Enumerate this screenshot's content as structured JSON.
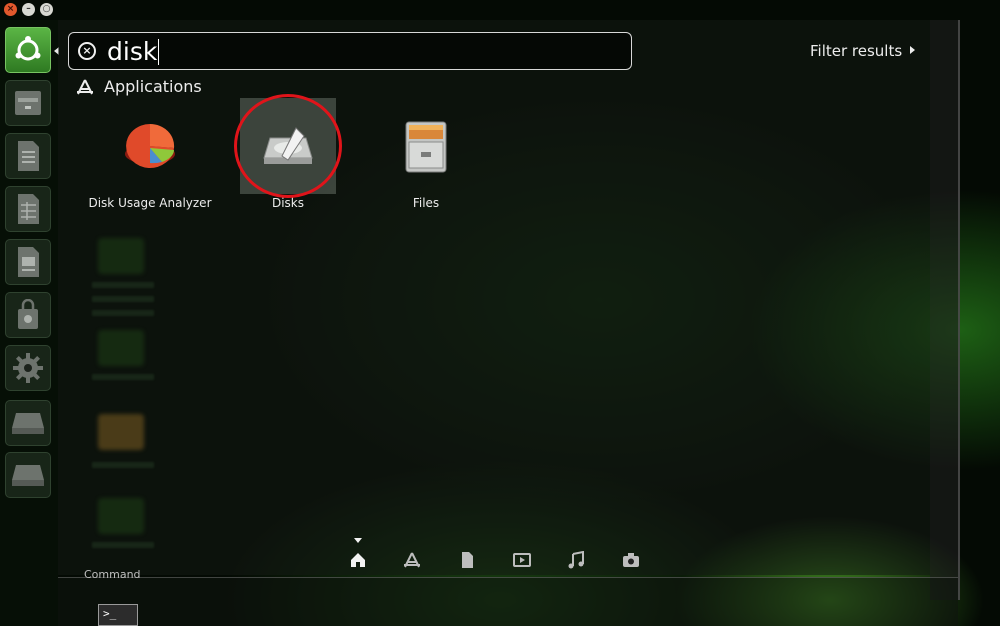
{
  "window_controls": {
    "close_glyph": "×",
    "minimize_glyph": "–",
    "maximize_glyph": "○"
  },
  "launcher": {
    "items": [
      {
        "icon": "ubuntu-logo-icon"
      },
      {
        "icon": "files-drawer-icon"
      },
      {
        "icon": "writer-document-icon"
      },
      {
        "icon": "calc-spreadsheet-icon"
      },
      {
        "icon": "impress-presentation-icon"
      },
      {
        "icon": "software-center-bag-icon"
      },
      {
        "icon": "system-settings-gear-icon"
      },
      {
        "icon": "drive-icon"
      },
      {
        "icon": "drive-icon"
      }
    ]
  },
  "search": {
    "query": "disk",
    "clear_glyph": "×"
  },
  "filter": {
    "label": "Filter results"
  },
  "section": {
    "title": "Applications",
    "icon": "applications-lens-icon"
  },
  "results": [
    {
      "label": "Disk Usage Analyzer",
      "icon": "pie-chart-icon"
    },
    {
      "label": "Disks",
      "icon": "disk-utility-icon",
      "selected": true
    },
    {
      "label": "Files",
      "icon": "file-cabinet-icon"
    }
  ],
  "lenses": [
    {
      "name": "home-lens",
      "active": true
    },
    {
      "name": "applications-lens"
    },
    {
      "name": "files-lens"
    },
    {
      "name": "video-lens"
    },
    {
      "name": "music-lens"
    },
    {
      "name": "photo-lens"
    }
  ],
  "bottom": {
    "partial_label": "Command",
    "terminal_prompt": ">_"
  },
  "colors": {
    "accent_green": "#4fa83a",
    "highlight_ring": "#e0141a"
  }
}
